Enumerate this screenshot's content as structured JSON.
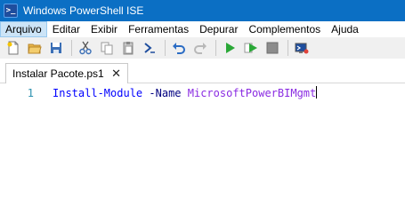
{
  "window": {
    "title": "Windows PowerShell ISE",
    "logo_glyph": ">_"
  },
  "menu": {
    "items": [
      {
        "label": "Arquivo",
        "active": true
      },
      {
        "label": "Editar"
      },
      {
        "label": "Exibir"
      },
      {
        "label": "Ferramentas"
      },
      {
        "label": "Depurar"
      },
      {
        "label": "Complementos"
      },
      {
        "label": "Ajuda"
      }
    ]
  },
  "toolbar": {
    "buttons": [
      {
        "name": "new-file-icon"
      },
      {
        "name": "open-folder-icon"
      },
      {
        "name": "save-icon"
      },
      {
        "name": "cut-icon"
      },
      {
        "name": "copy-icon"
      },
      {
        "name": "paste-icon"
      },
      {
        "name": "powershell-console-icon"
      },
      {
        "name": "undo-icon"
      },
      {
        "name": "redo-icon"
      },
      {
        "name": "run-script-icon"
      },
      {
        "name": "run-selection-icon"
      },
      {
        "name": "stop-icon"
      },
      {
        "name": "remote-powershell-icon"
      }
    ]
  },
  "tabs": [
    {
      "label": "Instalar Pacote.ps1",
      "close_glyph": "✕"
    }
  ],
  "editor": {
    "lines": [
      {
        "number": "1",
        "command": "Install-Module",
        "parameter": "-Name",
        "argument": "MicrosoftPowerBIMgmt"
      }
    ]
  },
  "colors": {
    "titlebar": "#0b6fc4",
    "command": "#0000ff",
    "parameter": "#000080",
    "argument": "#8a2be2",
    "line_number": "#2b91af"
  }
}
